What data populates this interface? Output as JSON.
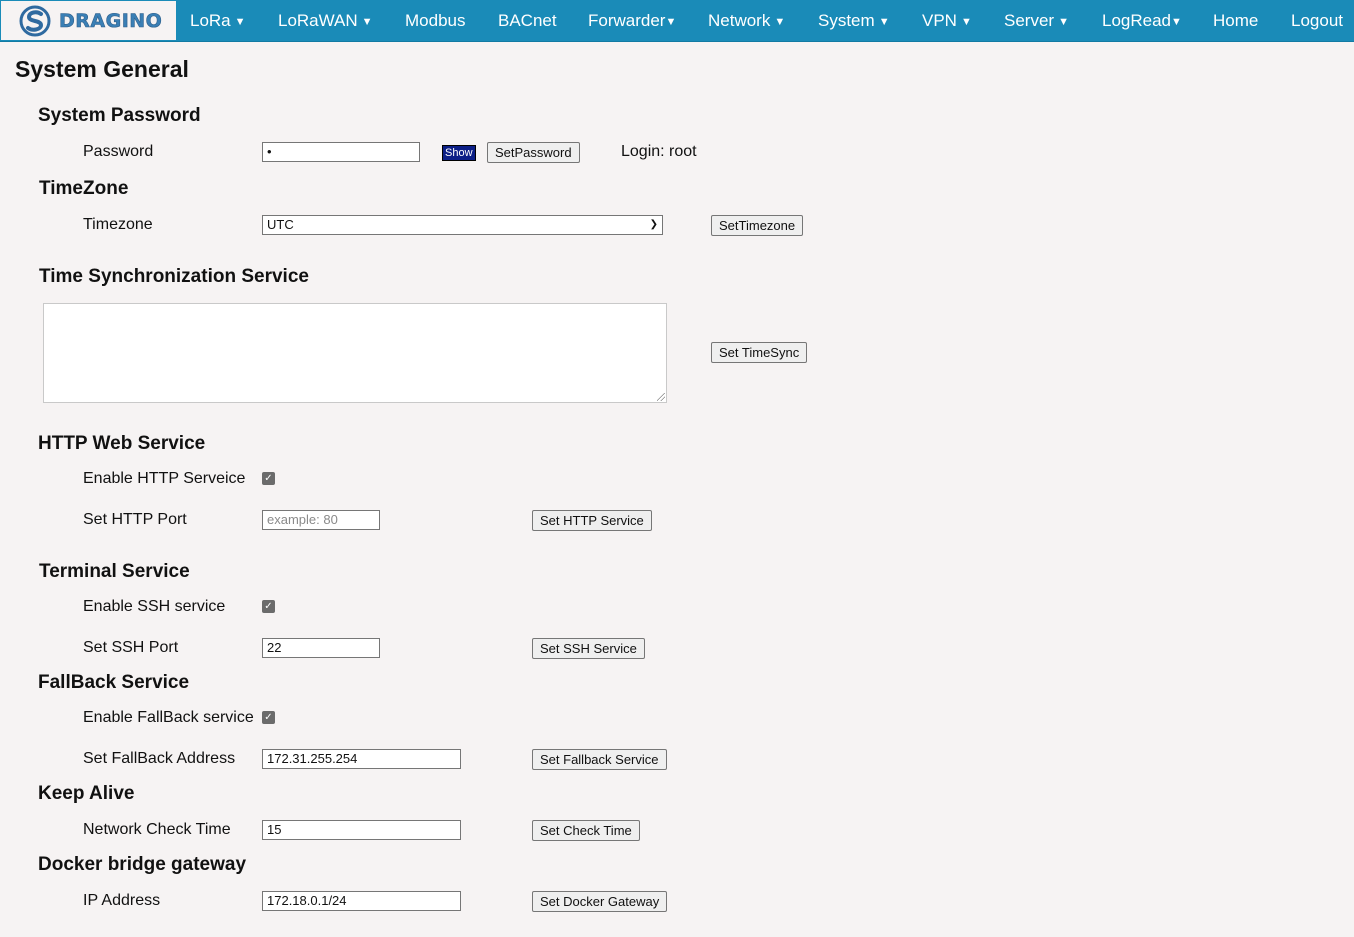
{
  "nav": {
    "logo_text": "DRAGINO",
    "items": [
      {
        "label": "LoRa",
        "dropdown": true
      },
      {
        "label": "LoRaWAN",
        "dropdown": true
      },
      {
        "label": "Modbus",
        "dropdown": false
      },
      {
        "label": "BACnet",
        "dropdown": false
      },
      {
        "label": "Forwarder",
        "dropdown": true
      },
      {
        "label": "Network",
        "dropdown": true
      },
      {
        "label": "System",
        "dropdown": true
      },
      {
        "label": "VPN",
        "dropdown": true
      },
      {
        "label": "Server",
        "dropdown": true
      },
      {
        "label": "LogRead",
        "dropdown": true
      },
      {
        "label": "Home",
        "dropdown": false
      },
      {
        "label": "Logout",
        "dropdown": false
      }
    ],
    "caret": "▼"
  },
  "page_title": "System General",
  "system_password": {
    "heading": "System Password",
    "label": "Password",
    "value": "•",
    "show_button": "Show",
    "set_button": "SetPassword",
    "login_text": "Login: root"
  },
  "timezone": {
    "heading": "TimeZone",
    "label": "Timezone",
    "selected": "UTC",
    "set_button": "SetTimezone"
  },
  "time_sync": {
    "heading": "Time Synchronization Service",
    "value": "",
    "set_button": "Set TimeSync"
  },
  "http": {
    "heading": "HTTP Web Service",
    "enable_label": "Enable HTTP Serveice",
    "enabled": true,
    "port_label": "Set HTTP Port",
    "port_placeholder": "example: 80",
    "set_button": "Set HTTP Service"
  },
  "terminal": {
    "heading": "Terminal Service",
    "enable_label": "Enable SSH service",
    "enabled": true,
    "port_label": "Set SSH Port",
    "port_value": "22",
    "set_button": "Set SSH Service"
  },
  "fallback": {
    "heading": "FallBack Service",
    "enable_label": "Enable FallBack service",
    "enabled": true,
    "address_label": "Set FallBack Address",
    "address_value": "172.31.255.254",
    "set_button": "Set Fallback Service"
  },
  "keep_alive": {
    "heading": "Keep Alive",
    "label": "Network Check Time",
    "value": "15",
    "set_button": "Set Check Time"
  },
  "docker": {
    "heading": "Docker bridge gateway",
    "label": "IP Address",
    "value": "172.18.0.1/24",
    "set_button": "Set Docker Gateway"
  },
  "colors": {
    "nav_bg": "#1a8bb8",
    "page_bg": "#f6f3f3",
    "show_button_bg": "#0c1f87",
    "logo_text": "#3a7fb5"
  },
  "icons": {
    "logo": "dragino-s-logo-icon",
    "checkbox": "checkmark-icon",
    "select": "chevron-down-icon"
  }
}
